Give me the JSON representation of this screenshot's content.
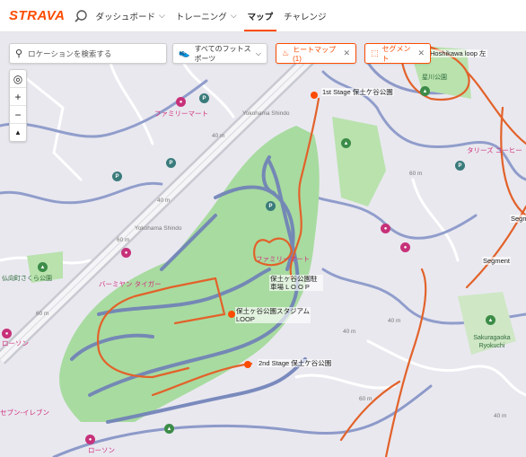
{
  "header": {
    "logo": "STRAVA",
    "nav": [
      {
        "label": "ダッシュボード",
        "chevron": true
      },
      {
        "label": "トレーニング",
        "chevron": true
      },
      {
        "label": "マップ",
        "chevron": false,
        "active": true
      },
      {
        "label": "チャレンジ",
        "chevron": false
      }
    ]
  },
  "controls": {
    "location_placeholder": "ロケーションを検索する",
    "sport_filter": "すべてのフットスポーツ",
    "heatmap_chip": "ヒートマップ (1)",
    "segment_chip": "セグメント",
    "zoom_in": "+",
    "zoom_out": "−",
    "compass": "▲",
    "locate": "◎"
  },
  "labels": {
    "segments": [
      "1st Stage 保土ケ谷公園",
      "2nd Stage 保土ケ谷公園",
      "保土ヶ谷公園駐車場 L O O P",
      "保土ヶ谷公園スタジアムLOOP",
      "Hoshikawa loop 左",
      "Segment",
      "Segm"
    ],
    "pois": [
      "ファミリーマート",
      "ファミリーマート",
      "バーミヤン タイガー",
      "ローソン",
      "ローソン",
      "セブン-イレブン",
      "タリーズ コーヒー"
    ],
    "roads": [
      "Yokohama Shindo",
      "Yokohama Shindo",
      "40 m",
      "40 m",
      "40 m",
      "40 m",
      "40 m",
      "60 m",
      "60 m",
      "60 m",
      "60 m"
    ],
    "parks": [
      "仏向町さくら公園",
      "Sakuragaoka Ryokuchi",
      "星川公園"
    ]
  },
  "colors": {
    "accent": "#fc4c02",
    "map_bg": "#e9e8ef",
    "park": "#a8dba0",
    "heat": "#6f80b8",
    "segment_line": "#e2622a"
  }
}
